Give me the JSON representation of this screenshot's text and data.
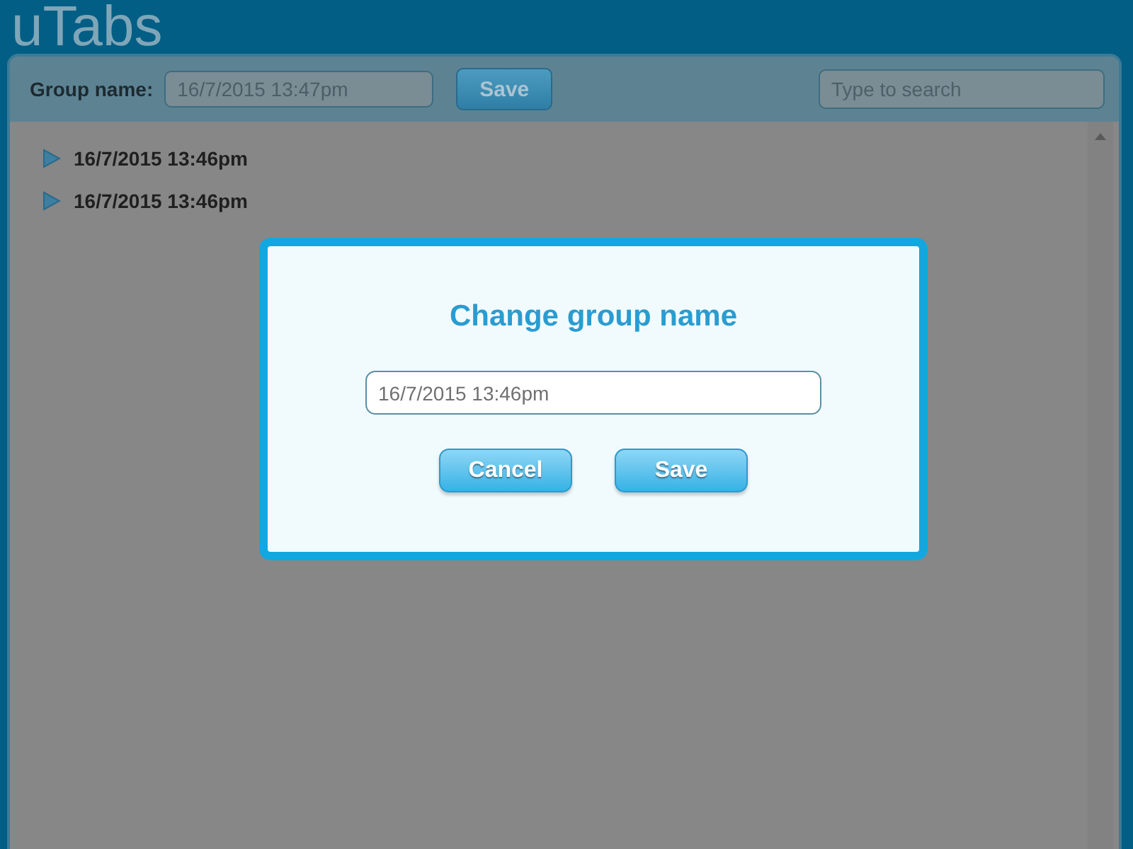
{
  "app": {
    "title": "uTabs"
  },
  "toolbar": {
    "group_label": "Group name:",
    "group_value": "16/7/2015 13:47pm",
    "save_button": "Save",
    "search": {
      "placeholder": "Type to search"
    }
  },
  "groups": [
    {
      "label": "16/7/2015 13:46pm",
      "expanded": false
    },
    {
      "label": "16/7/2015 13:46pm",
      "expanded": false
    }
  ],
  "dialog": {
    "title": "Change group name",
    "value": "16/7/2015 13:46pm",
    "buttons": [
      "Cancel",
      "Save"
    ]
  }
}
